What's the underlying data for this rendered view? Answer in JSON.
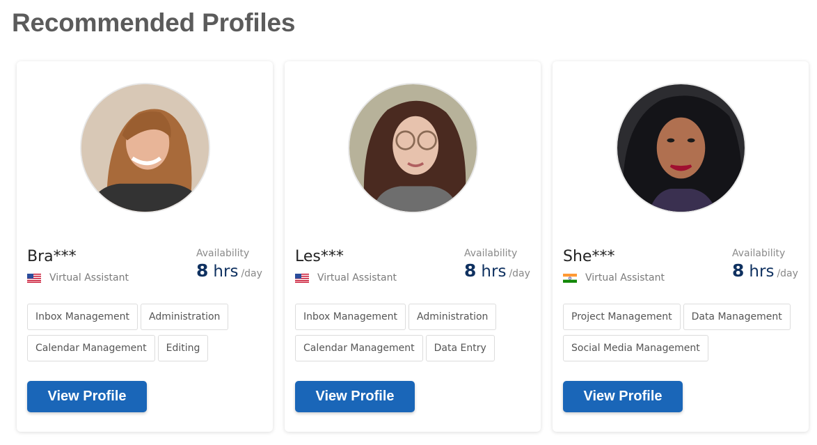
{
  "page": {
    "title": "Recommended Profiles"
  },
  "profiles": [
    {
      "name": "Bra***",
      "country_flag": "us-flag-icon",
      "role": "Virtual Assistant",
      "availability_label": "Availability",
      "hours": "8",
      "hours_unit": "hrs",
      "per": "/day",
      "skills_rows": [
        [
          "Inbox Management",
          "Administration"
        ],
        [
          "Calendar Management",
          "Editing"
        ]
      ],
      "button_label": "View Profile"
    },
    {
      "name": "Les***",
      "country_flag": "us-flag-icon",
      "role": "Virtual Assistant",
      "availability_label": "Availability",
      "hours": "8",
      "hours_unit": "hrs",
      "per": "/day",
      "skills_rows": [
        [
          "Inbox Management",
          "Administration"
        ],
        [
          "Calendar Management",
          "Data Entry"
        ]
      ],
      "button_label": "View Profile"
    },
    {
      "name": "She***",
      "country_flag": "india-flag-icon",
      "role": "Virtual Assistant",
      "availability_label": "Availability",
      "hours": "8",
      "hours_unit": "hrs",
      "per": "/day",
      "skills_rows": [
        [
          "Project Management",
          "Data Management"
        ],
        [
          "Social Media Management"
        ]
      ],
      "button_label": "View Profile"
    }
  ],
  "colors": {
    "title": "#5b5b5b",
    "button": "#1a66b8",
    "hours": "#0f3160"
  }
}
